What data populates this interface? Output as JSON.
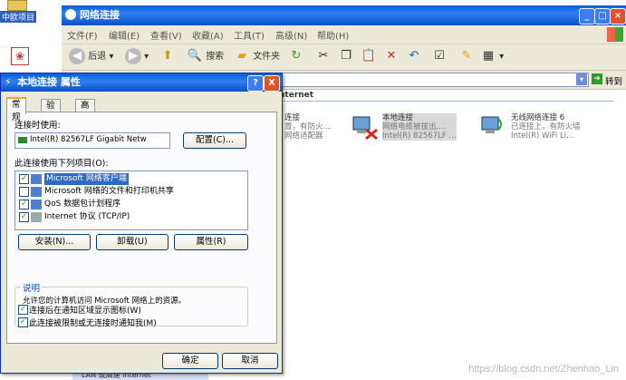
{
  "background_window": {
    "title": "网络连接",
    "menu": [
      "文件(F)",
      "编辑(E)",
      "查看(V)",
      "收藏(A)",
      "工具(T)",
      "高级(N)",
      "帮助(H)"
    ],
    "toolbar": {
      "back_label": "后退",
      "search_label": "搜索",
      "folders_label": "文件夹"
    },
    "address_go_label": "转到",
    "list_header": "nternet",
    "connections": [
      {
        "name": "连接",
        "line2": "置，有防火...",
        "line3": "网络适配器"
      },
      {
        "name": "本地连接",
        "line2": "网络电缆被拔出,...",
        "line3": "Intel(R) 82567LF ..."
      },
      {
        "name": "无线网络连接 6",
        "line2": "已连接上，有防火墙",
        "line3": "Intel(R) WiFi Li..."
      }
    ]
  },
  "desktop": {
    "icon_label": "中欧项目"
  },
  "dialog": {
    "title": "本地连接 属性",
    "help_button": "?",
    "close_button": "X",
    "tabs": [
      "常规",
      "验证",
      "高级"
    ],
    "connect_using_label": "连接时使用:",
    "adapter_name": "Intel(R) 82567LF Gigabit Netw",
    "configure_button": "配置(C)...",
    "items_label": "此连接使用下列项目(O):",
    "items": [
      {
        "label": "Microsoft 网络客户端",
        "checked": true,
        "selected": true
      },
      {
        "label": "Microsoft 网络的文件和打印机共享",
        "checked": false,
        "selected": false
      },
      {
        "label": "QoS 数据包计划程序",
        "checked": true,
        "selected": false
      },
      {
        "label": "Internet 协议 (TCP/IP)",
        "checked": true,
        "selected": false
      }
    ],
    "install_button": "安装(N)...",
    "uninstall_button": "卸载(U)",
    "properties_button": "属性(R)",
    "description_legend": "说明",
    "description_text": "允许您的计算机访问 Microsoft 网络上的资源。",
    "option_show_icon": "连接后在通知区域显示图标(W)",
    "option_notify": "此连接被限制或无连接时通知我(M)",
    "ok_button": "确定",
    "cancel_button": "取消"
  },
  "taskbar_fragment": "LAN 或高速 Internet",
  "watermark": "https://blog.csdn.net/Zhenhao_Lin",
  "colors": {
    "titlebar": "#0a5fd8",
    "dialog_face": "#ece9d8",
    "selection": "#316ac5",
    "tab_highlight": "#f5a623"
  }
}
